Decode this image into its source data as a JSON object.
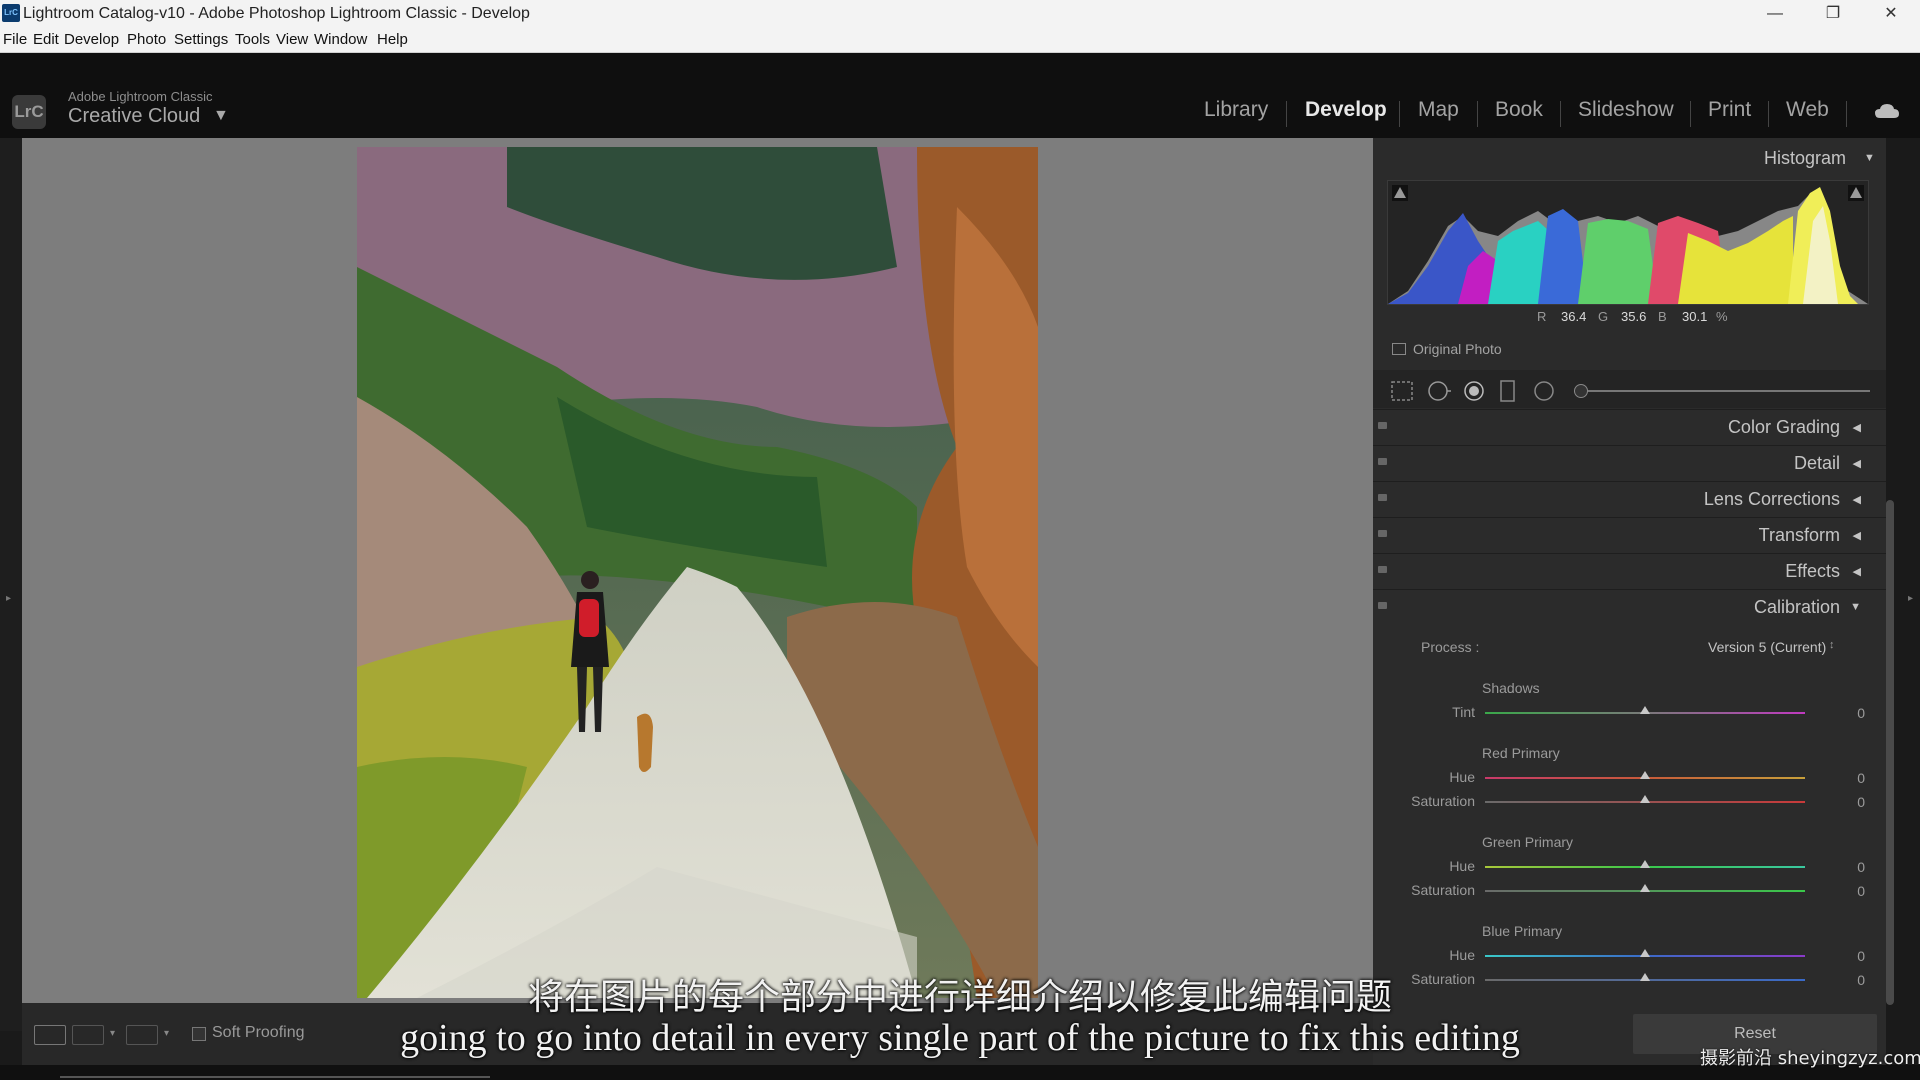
{
  "window": {
    "app_icon": "LrC",
    "title": "Lightroom Catalog-v10 - Adobe Photoshop Lightroom Classic - Develop",
    "controls": [
      "—",
      "❐",
      "✕"
    ]
  },
  "menu": [
    "File",
    "Edit",
    "Develop",
    "Photo",
    "Settings",
    "Tools",
    "View",
    "Window",
    "Help"
  ],
  "identity": {
    "badge": "LrC",
    "small": "Adobe Lightroom Classic",
    "big": "Creative Cloud",
    "arrow": "▼"
  },
  "modules": {
    "items": [
      "Library",
      "Develop",
      "Map",
      "Book",
      "Slideshow",
      "Print",
      "Web"
    ],
    "active": "Develop"
  },
  "histogram": {
    "title": "Histogram",
    "r_label": "R",
    "r": "36.4",
    "g_label": "G",
    "g": "35.6",
    "b_label": "B",
    "b": "30.1",
    "unit": "%"
  },
  "original_photo": "Original Photo",
  "sections": [
    {
      "label": "Color Grading",
      "arrow": "◀"
    },
    {
      "label": "Detail",
      "arrow": "◀"
    },
    {
      "label": "Lens Corrections",
      "arrow": "◀"
    },
    {
      "label": "Transform",
      "arrow": "◀"
    },
    {
      "label": "Effects",
      "arrow": "◀"
    },
    {
      "label": "Calibration",
      "arrow": "▼"
    }
  ],
  "calibration": {
    "process_label": "Process :",
    "process_value": "Version 5 (Current)",
    "process_arrow": "↕",
    "shadows": {
      "title": "Shadows",
      "tint_label": "Tint",
      "tint": "0"
    },
    "red": {
      "title": "Red Primary",
      "hue_label": "Hue",
      "hue": "0",
      "sat_label": "Saturation",
      "sat": "0"
    },
    "green": {
      "title": "Green Primary",
      "hue_label": "Hue",
      "hue": "0",
      "sat_label": "Saturation",
      "sat": "0"
    },
    "blue": {
      "title": "Blue Primary",
      "hue_label": "Hue",
      "hue": "0",
      "sat_label": "Saturation",
      "sat": "0"
    }
  },
  "reset_label": "Reset",
  "toolbar": {
    "soft_proof": "Soft Proofing"
  },
  "subtitles": {
    "cn": "将在图片的每个部分中进行详细介绍以修复此编辑问题",
    "en": "going to go into detail in every single part of the picture to fix this editing"
  },
  "watermark": "摄影前沿 sheyingzyz.com",
  "icons": {
    "cloud": "cloud-sync-icon",
    "tools": [
      "crop-icon",
      "spot-removal-icon",
      "masking-icon",
      "red-eye-icon",
      "presets-icon"
    ]
  },
  "colors": {
    "accent": "#e8e8e8",
    "panel": "#2b2b2b",
    "canvas": "#7d7d7d"
  }
}
